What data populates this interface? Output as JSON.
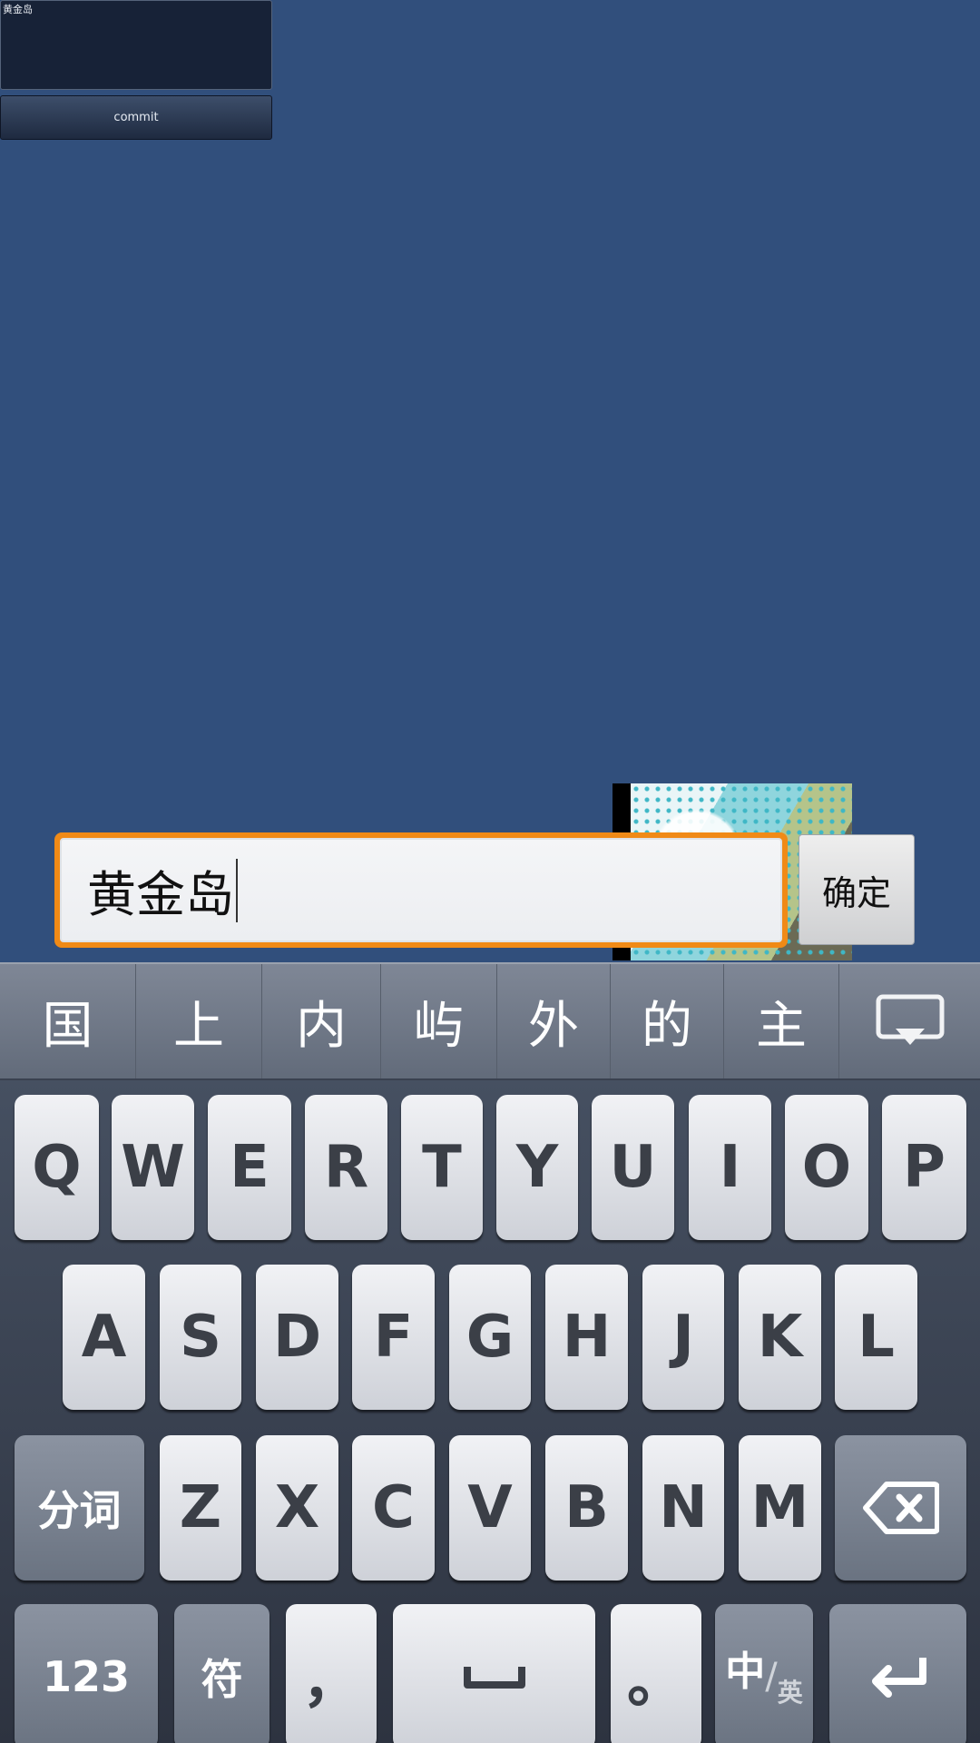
{
  "top_panel": {
    "text": "黄金岛",
    "commit_label": "commit"
  },
  "input": {
    "value": "黄金岛",
    "confirm_label": "确定"
  },
  "candidates": [
    "国",
    "上",
    "内",
    "屿",
    "外",
    "的",
    "主"
  ],
  "keyboard": {
    "row1": [
      "Q",
      "W",
      "E",
      "R",
      "T",
      "Y",
      "U",
      "I",
      "O",
      "P"
    ],
    "row2": [
      "A",
      "S",
      "D",
      "F",
      "G",
      "H",
      "J",
      "K",
      "L"
    ],
    "row3": [
      "Z",
      "X",
      "C",
      "V",
      "B",
      "N",
      "M"
    ],
    "segment_label": "分词",
    "num_label": "123",
    "symbol_label": "符",
    "comma_label": "，",
    "period_label": "。",
    "lang_main": "中",
    "lang_sub": "英",
    "colors": {
      "accent_border": "#f08a16",
      "background": "#314f7c"
    },
    "icons": [
      "hide-keyboard-icon",
      "backspace-icon",
      "space-icon",
      "enter-icon"
    ]
  }
}
